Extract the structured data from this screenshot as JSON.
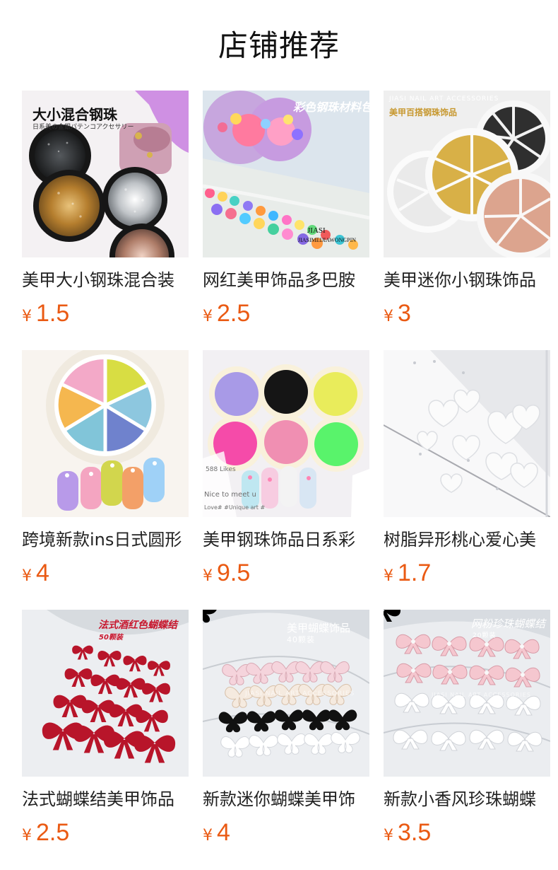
{
  "page": {
    "title": "店铺推荐"
  },
  "theme": {
    "price_color": "#ea5a13",
    "title_color": "#111111",
    "text_color": "#222222",
    "background": "#ffffff"
  },
  "currency_symbol": "¥",
  "products": [
    {
      "title": "美甲大小钢珠混合装",
      "price": "1.5",
      "image": {
        "headline": "大小混合钢珠",
        "subline": "日系美の金銀パテンコアクセサリー"
      }
    },
    {
      "title": "网红美甲饰品多巴胺",
      "price": "2.5",
      "image": {
        "headline": "彩色钢珠材料包",
        "brand": "JIASI",
        "brand_line": "JIASIMEIJIAWONGPIN"
      }
    },
    {
      "title": "美甲迷你小钢珠饰品",
      "price": "3",
      "image": {
        "brand": "JIASI NAIL ART ACCESSORIES",
        "headline": "美甲百搭钢珠饰品"
      }
    },
    {
      "title": "跨境新款ins日式圆形",
      "price": "4",
      "image": {}
    },
    {
      "title": "美甲钢珠饰品日系彩",
      "price": "9.5",
      "image": {
        "side_text": "588 Likes",
        "card_text": "Nice to meet u",
        "tag_text": "Love# #Unique art #"
      }
    },
    {
      "title": "树脂异形桃心爱心美",
      "price": "1.7",
      "image": {}
    },
    {
      "title": "法式蝴蝶结美甲饰品",
      "price": "2.5",
      "image": {
        "headline": "法式酒红色蝴蝶结",
        "subline": "50颗装"
      }
    },
    {
      "title": "新款迷你蝴蝶美甲饰",
      "price": "4",
      "image": {
        "headline": "美甲蝴蝶饰品",
        "subline": "40颗装",
        "brand": "JIASI NAIL ART ACCESSORIES"
      }
    },
    {
      "title": "新款小香风珍珠蝴蝶",
      "price": "3.5",
      "image": {
        "headline": "网粉珍珠蝴蝶结",
        "subline": "20颗装",
        "brand": "JIASI NAIL ART ACCESSORIES"
      }
    }
  ]
}
